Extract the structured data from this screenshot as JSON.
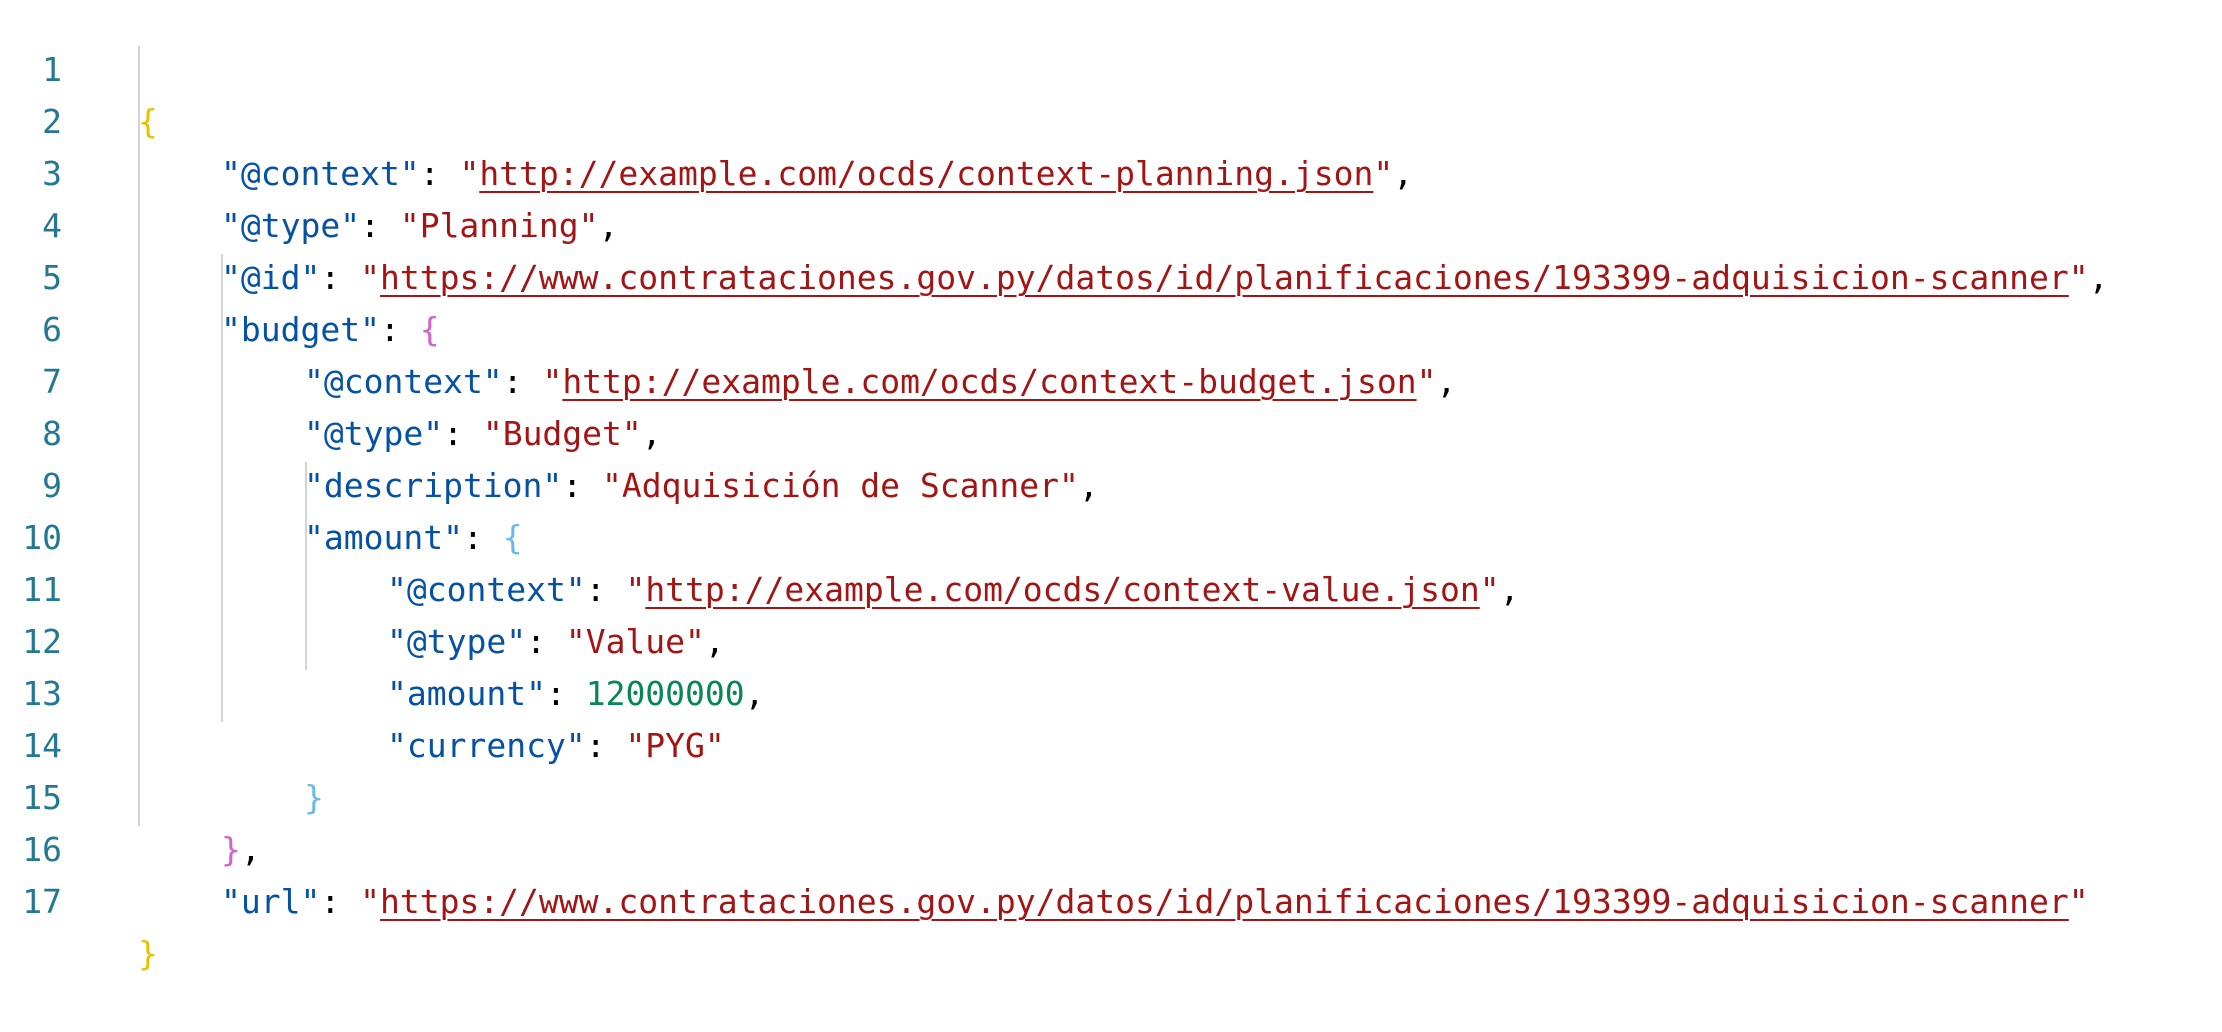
{
  "editor": {
    "line_numbers": [
      "1",
      "2",
      "3",
      "4",
      "5",
      "6",
      "7",
      "8",
      "9",
      "10",
      "11",
      "12",
      "13",
      "14",
      "15",
      "16",
      "17"
    ],
    "colors": {
      "line_number": "#237893",
      "key": "#0451a5",
      "string": "#a31515",
      "number": "#098658",
      "bracket_level1": "#e8c200",
      "bracket_level2": "#d262c8",
      "bracket_level3": "#6ab8ec",
      "indent_guide": "#d4d4d4"
    }
  },
  "json": {
    "open_brace": "{",
    "close_brace": "}",
    "context_key": "\"@context\"",
    "context_val": "http://example.com/ocds/context-planning.json",
    "type_key": "\"@type\"",
    "type_val": "\"Planning\"",
    "id_key": "\"@id\"",
    "id_val": "https://www.contrataciones.gov.py/datos/id/planificaciones/193399-adquisicion-scanner",
    "budget_key": "\"budget\"",
    "budget": {
      "open_brace": "{",
      "close_brace": "}",
      "context_key": "\"@context\"",
      "context_val": "http://example.com/ocds/context-budget.json",
      "type_key": "\"@type\"",
      "type_val": "\"Budget\"",
      "description_key": "\"description\"",
      "description_val": "\"Adquisición de Scanner\"",
      "amount_key": "\"amount\"",
      "amount": {
        "open_brace": "{",
        "close_brace": "}",
        "context_key": "\"@context\"",
        "context_val": "http://example.com/ocds/context-value.json",
        "type_key": "\"@type\"",
        "type_val": "\"Value\"",
        "amount_key": "\"amount\"",
        "amount_val": "12000000",
        "currency_key": "\"currency\"",
        "currency_val": "\"PYG\""
      }
    },
    "url_key": "\"url\"",
    "url_val": "https://www.contrataciones.gov.py/datos/id/planificaciones/193399-adquisicion-scanner"
  }
}
